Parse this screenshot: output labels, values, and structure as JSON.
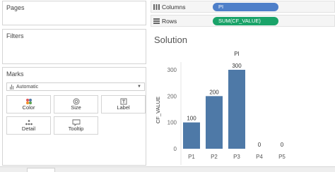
{
  "left_panel": {
    "pages_title": "Pages",
    "filters_title": "Filters",
    "marks": {
      "title": "Marks",
      "mark_type": "Automatic",
      "buttons": {
        "color": "Color",
        "size": "Size",
        "label": "Label",
        "detail": "Detail",
        "tooltip": "Tooltip"
      }
    }
  },
  "shelves": {
    "columns": {
      "label": "Columns",
      "pill": "PI"
    },
    "rows": {
      "label": "Rows",
      "pill": "SUM(CF_VALUE)"
    }
  },
  "worksheet": {
    "title": "Solution"
  },
  "colors": {
    "bar": "#4e79a7",
    "pill_columns": "#4e7fc9",
    "pill_rows": "#1aa369"
  },
  "chart_data": {
    "type": "bar",
    "title": "PI",
    "categories": [
      "P1",
      "P2",
      "P3",
      "P4",
      "P5"
    ],
    "values": [
      100,
      200,
      300,
      0,
      0
    ],
    "data_labels": [
      "100",
      "200",
      "300",
      "0",
      "0"
    ],
    "ylabel": "CF_VALUE",
    "xlabel": "",
    "yticks": [
      0,
      100,
      200,
      300
    ],
    "ylim": [
      0,
      300
    ],
    "grid": false,
    "bar_color": "#4e79a7"
  }
}
